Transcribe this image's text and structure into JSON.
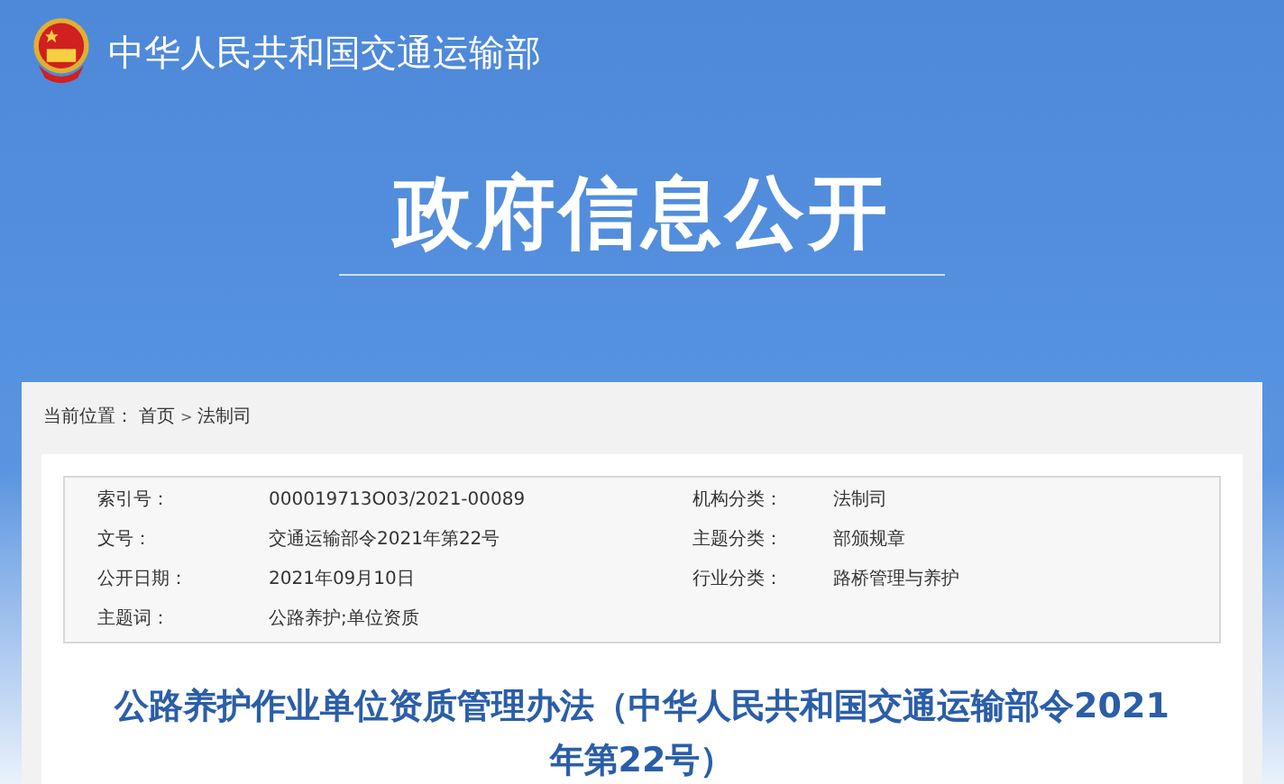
{
  "header": {
    "site_name": "中华人民共和国交通运输部",
    "banner_title": "政府信息公开"
  },
  "breadcrumb": {
    "label": "当前位置：",
    "separator": ">",
    "items": [
      "首页",
      "法制司"
    ]
  },
  "meta": [
    {
      "label": "索引号：",
      "value": "000019713O03/2021-00089"
    },
    {
      "label": "机构分类：",
      "value": "法制司"
    },
    {
      "label": "文号：",
      "value": "交通运输部令2021年第22号"
    },
    {
      "label": "主题分类：",
      "value": "部颁规章"
    },
    {
      "label": "公开日期：",
      "value": "2021年09月10日"
    },
    {
      "label": "行业分类：",
      "value": "路桥管理与养护"
    },
    {
      "label": "主题词：",
      "value": "公路养护;单位资质"
    }
  ],
  "article": {
    "title": "公路养护作业单位资质管理办法（中华人民共和国交通运输部令2021年第22号）"
  }
}
